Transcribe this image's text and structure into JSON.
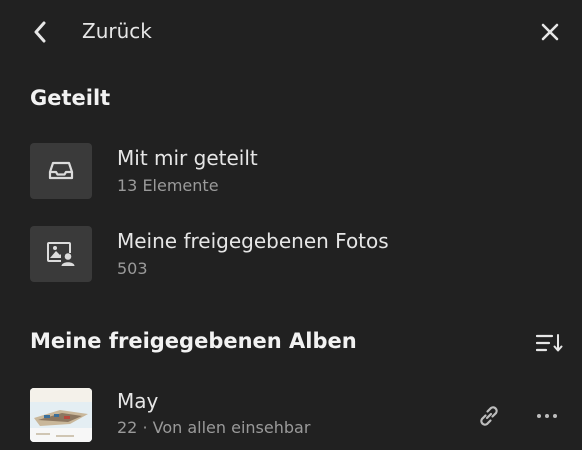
{
  "header": {
    "back_label": "Zurück"
  },
  "shared_section": {
    "title": "Geteilt",
    "items": [
      {
        "title": "Mit mir geteilt",
        "subtitle": "13 Elemente",
        "icon": "inbox-tray-icon"
      },
      {
        "title": "Meine freigegebenen Fotos",
        "subtitle": "503",
        "icon": "shared-photo-person-icon"
      }
    ]
  },
  "albums_section": {
    "title": "Meine freigegebenen Alben",
    "sort_icon": "sort-icon",
    "albums": [
      {
        "title": "May",
        "subtitle": "22 · Von allen einsehbar"
      }
    ]
  },
  "colors": {
    "background": "#212121",
    "tile": "#3a3a3a",
    "text_primary": "#e6e6e6",
    "text_secondary": "#9a9a9a"
  }
}
